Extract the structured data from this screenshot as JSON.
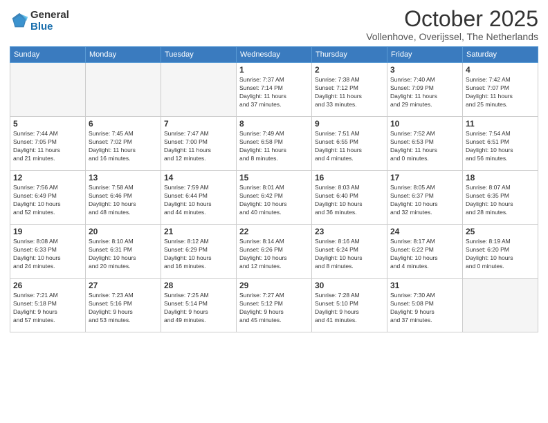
{
  "logo": {
    "general": "General",
    "blue": "Blue"
  },
  "title": "October 2025",
  "location": "Vollenhove, Overijssel, The Netherlands",
  "weekdays": [
    "Sunday",
    "Monday",
    "Tuesday",
    "Wednesday",
    "Thursday",
    "Friday",
    "Saturday"
  ],
  "weeks": [
    [
      {
        "day": "",
        "info": ""
      },
      {
        "day": "",
        "info": ""
      },
      {
        "day": "",
        "info": ""
      },
      {
        "day": "1",
        "info": "Sunrise: 7:37 AM\nSunset: 7:14 PM\nDaylight: 11 hours\nand 37 minutes."
      },
      {
        "day": "2",
        "info": "Sunrise: 7:38 AM\nSunset: 7:12 PM\nDaylight: 11 hours\nand 33 minutes."
      },
      {
        "day": "3",
        "info": "Sunrise: 7:40 AM\nSunset: 7:09 PM\nDaylight: 11 hours\nand 29 minutes."
      },
      {
        "day": "4",
        "info": "Sunrise: 7:42 AM\nSunset: 7:07 PM\nDaylight: 11 hours\nand 25 minutes."
      }
    ],
    [
      {
        "day": "5",
        "info": "Sunrise: 7:44 AM\nSunset: 7:05 PM\nDaylight: 11 hours\nand 21 minutes."
      },
      {
        "day": "6",
        "info": "Sunrise: 7:45 AM\nSunset: 7:02 PM\nDaylight: 11 hours\nand 16 minutes."
      },
      {
        "day": "7",
        "info": "Sunrise: 7:47 AM\nSunset: 7:00 PM\nDaylight: 11 hours\nand 12 minutes."
      },
      {
        "day": "8",
        "info": "Sunrise: 7:49 AM\nSunset: 6:58 PM\nDaylight: 11 hours\nand 8 minutes."
      },
      {
        "day": "9",
        "info": "Sunrise: 7:51 AM\nSunset: 6:55 PM\nDaylight: 11 hours\nand 4 minutes."
      },
      {
        "day": "10",
        "info": "Sunrise: 7:52 AM\nSunset: 6:53 PM\nDaylight: 11 hours\nand 0 minutes."
      },
      {
        "day": "11",
        "info": "Sunrise: 7:54 AM\nSunset: 6:51 PM\nDaylight: 10 hours\nand 56 minutes."
      }
    ],
    [
      {
        "day": "12",
        "info": "Sunrise: 7:56 AM\nSunset: 6:49 PM\nDaylight: 10 hours\nand 52 minutes."
      },
      {
        "day": "13",
        "info": "Sunrise: 7:58 AM\nSunset: 6:46 PM\nDaylight: 10 hours\nand 48 minutes."
      },
      {
        "day": "14",
        "info": "Sunrise: 7:59 AM\nSunset: 6:44 PM\nDaylight: 10 hours\nand 44 minutes."
      },
      {
        "day": "15",
        "info": "Sunrise: 8:01 AM\nSunset: 6:42 PM\nDaylight: 10 hours\nand 40 minutes."
      },
      {
        "day": "16",
        "info": "Sunrise: 8:03 AM\nSunset: 6:40 PM\nDaylight: 10 hours\nand 36 minutes."
      },
      {
        "day": "17",
        "info": "Sunrise: 8:05 AM\nSunset: 6:37 PM\nDaylight: 10 hours\nand 32 minutes."
      },
      {
        "day": "18",
        "info": "Sunrise: 8:07 AM\nSunset: 6:35 PM\nDaylight: 10 hours\nand 28 minutes."
      }
    ],
    [
      {
        "day": "19",
        "info": "Sunrise: 8:08 AM\nSunset: 6:33 PM\nDaylight: 10 hours\nand 24 minutes."
      },
      {
        "day": "20",
        "info": "Sunrise: 8:10 AM\nSunset: 6:31 PM\nDaylight: 10 hours\nand 20 minutes."
      },
      {
        "day": "21",
        "info": "Sunrise: 8:12 AM\nSunset: 6:29 PM\nDaylight: 10 hours\nand 16 minutes."
      },
      {
        "day": "22",
        "info": "Sunrise: 8:14 AM\nSunset: 6:26 PM\nDaylight: 10 hours\nand 12 minutes."
      },
      {
        "day": "23",
        "info": "Sunrise: 8:16 AM\nSunset: 6:24 PM\nDaylight: 10 hours\nand 8 minutes."
      },
      {
        "day": "24",
        "info": "Sunrise: 8:17 AM\nSunset: 6:22 PM\nDaylight: 10 hours\nand 4 minutes."
      },
      {
        "day": "25",
        "info": "Sunrise: 8:19 AM\nSunset: 6:20 PM\nDaylight: 10 hours\nand 0 minutes."
      }
    ],
    [
      {
        "day": "26",
        "info": "Sunrise: 7:21 AM\nSunset: 5:18 PM\nDaylight: 9 hours\nand 57 minutes."
      },
      {
        "day": "27",
        "info": "Sunrise: 7:23 AM\nSunset: 5:16 PM\nDaylight: 9 hours\nand 53 minutes."
      },
      {
        "day": "28",
        "info": "Sunrise: 7:25 AM\nSunset: 5:14 PM\nDaylight: 9 hours\nand 49 minutes."
      },
      {
        "day": "29",
        "info": "Sunrise: 7:27 AM\nSunset: 5:12 PM\nDaylight: 9 hours\nand 45 minutes."
      },
      {
        "day": "30",
        "info": "Sunrise: 7:28 AM\nSunset: 5:10 PM\nDaylight: 9 hours\nand 41 minutes."
      },
      {
        "day": "31",
        "info": "Sunrise: 7:30 AM\nSunset: 5:08 PM\nDaylight: 9 hours\nand 37 minutes."
      },
      {
        "day": "",
        "info": ""
      }
    ]
  ]
}
